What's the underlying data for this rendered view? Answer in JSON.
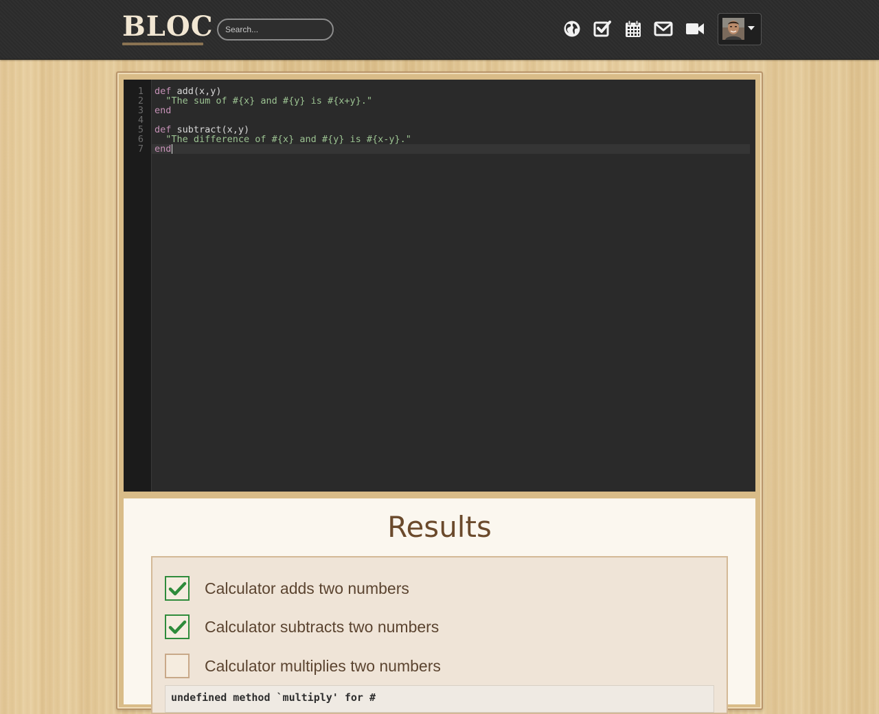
{
  "header": {
    "logo": "BLOC",
    "search_placeholder": "Search...",
    "nav_icons": [
      "globe-icon",
      "checkbox-icon",
      "calendar-icon",
      "mail-icon",
      "video-icon"
    ],
    "avatar": "user-avatar"
  },
  "editor": {
    "line_numbers": [
      "1",
      "2",
      "3",
      "4",
      "5",
      "6",
      "7"
    ],
    "lines": [
      {
        "keyword": "def",
        "rest": " add(x,y)"
      },
      {
        "string": "  \"The sum of #{x} and #{y} is #{x+y}.\""
      },
      {
        "keyword": "end"
      },
      {},
      {
        "keyword": "def",
        "rest": " subtract(x,y)"
      },
      {
        "string": "  \"The difference of #{x} and #{y} is #{x-y}.\""
      },
      {
        "keyword": "end"
      }
    ]
  },
  "results": {
    "title": "Results",
    "tests": [
      {
        "label": "Calculator adds two numbers",
        "passed": true
      },
      {
        "label": "Calculator subtracts two numbers",
        "passed": true
      },
      {
        "label": "Calculator multiplies two numbers",
        "passed": false
      }
    ],
    "error": "undefined method `multiply' for #"
  },
  "colors": {
    "pass": "#2e8b3a",
    "keyword": "#c792b8",
    "string": "#9cc392",
    "title": "#6b4a2c"
  }
}
